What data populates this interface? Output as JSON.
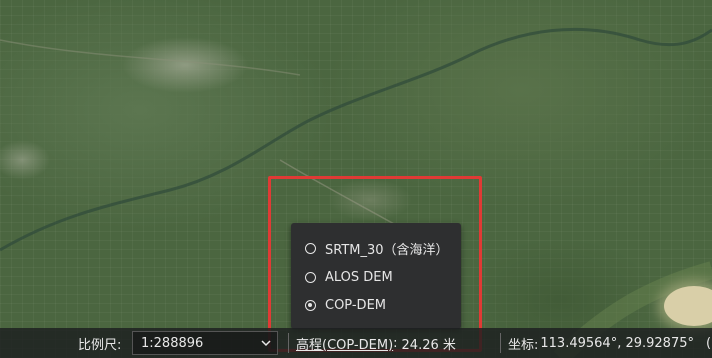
{
  "map": {
    "description_color": "#4b6640"
  },
  "dem_popup": {
    "options": [
      {
        "label": "SRTM_30（含海洋）",
        "selected": false
      },
      {
        "label": "ALOS DEM",
        "selected": false
      },
      {
        "label": "COP-DEM",
        "selected": true
      }
    ]
  },
  "status_bar": {
    "scale_label": "比例尺:",
    "scale_value": "1:288896",
    "elevation_label": "高程(COP-DEM)",
    "elevation_separator": ":",
    "elevation_value": "24.26 米",
    "coordinate_label": "坐标:",
    "coordinate_value": "113.49564°, 29.92875°",
    "coordinate_suffix": "("
  },
  "colors": {
    "highlight": "#e03a35",
    "popup_bg": "#2e2f30"
  }
}
